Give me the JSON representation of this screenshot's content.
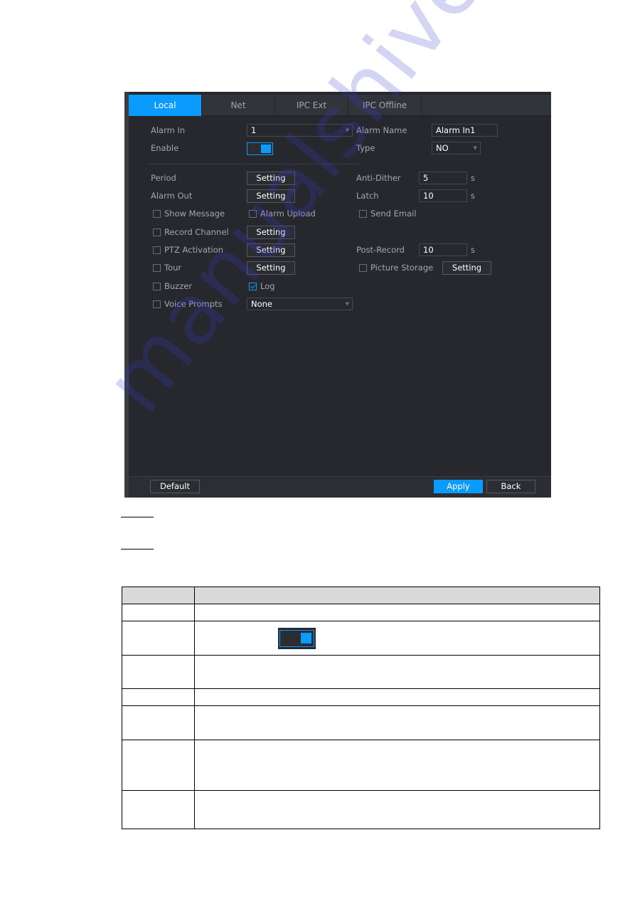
{
  "tabs": [
    {
      "label": "Local",
      "active": true
    },
    {
      "label": "Net",
      "active": false
    },
    {
      "label": "IPC Ext",
      "active": false
    },
    {
      "label": "IPC Offline",
      "active": false
    }
  ],
  "form": {
    "alarm_in": {
      "label": "Alarm In",
      "value": "1"
    },
    "alarm_name": {
      "label": "Alarm Name",
      "value": "Alarm In1"
    },
    "enable": {
      "label": "Enable",
      "on": true
    },
    "type": {
      "label": "Type",
      "value": "NO"
    },
    "period": {
      "label": "Period",
      "button": "Setting"
    },
    "anti_dither": {
      "label": "Anti-Dither",
      "value": "5",
      "unit": "s"
    },
    "alarm_out": {
      "label": "Alarm Out",
      "button": "Setting"
    },
    "latch": {
      "label": "Latch",
      "value": "10",
      "unit": "s"
    },
    "show_message": {
      "label": "Show Message",
      "checked": false
    },
    "alarm_upload": {
      "label": "Alarm Upload",
      "checked": false
    },
    "send_email": {
      "label": "Send Email",
      "checked": false
    },
    "record_channel": {
      "label": "Record Channel",
      "checked": false,
      "button": "Setting"
    },
    "ptz_activation": {
      "label": "PTZ Activation",
      "checked": false,
      "button": "Setting"
    },
    "post_record": {
      "label": "Post-Record",
      "value": "10",
      "unit": "s"
    },
    "tour": {
      "label": "Tour",
      "checked": false,
      "button": "Setting"
    },
    "picture_storage": {
      "label": "Picture Storage",
      "checked": false,
      "button": "Setting"
    },
    "buzzer": {
      "label": "Buzzer",
      "checked": false
    },
    "log": {
      "label": "Log",
      "checked": true
    },
    "voice_prompts": {
      "label": "Voice Prompts",
      "checked": false,
      "value": "None"
    }
  },
  "footer": {
    "default_label": "Default",
    "apply_label": "Apply",
    "back_label": "Back"
  },
  "colors": {
    "accent": "#0a9bff",
    "panel_bg": "#26282d"
  },
  "watermark": "manualshive.com"
}
